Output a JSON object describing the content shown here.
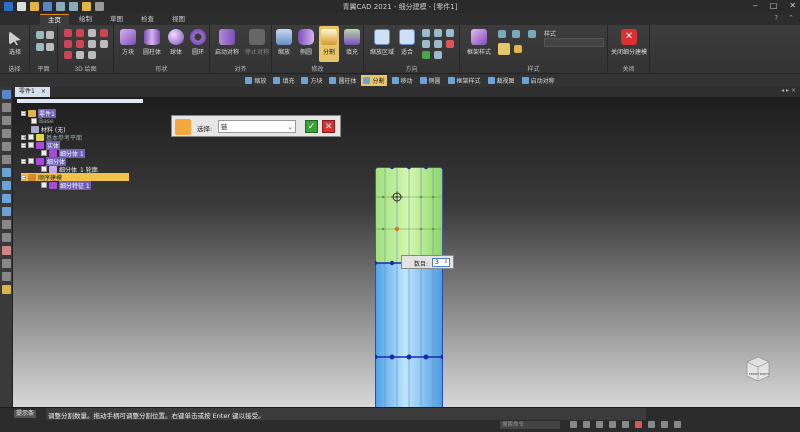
{
  "window": {
    "title": "青翼CAD 2021 - 细分建模 - [零件1]",
    "controls": [
      "‒",
      "□",
      "✕"
    ]
  },
  "ribbon_tabs": [
    "主页",
    "绘制",
    "草图",
    "检查",
    "视图"
  ],
  "ribbon_tab_active": "主页",
  "ribbon": {
    "groups": {
      "select": "选择",
      "plane": "平面",
      "sketch3d": "3D 绘图",
      "shape": "形状",
      "align": "对齐",
      "modify": "修改",
      "direction": "方向",
      "style": "样式",
      "close": "关闭"
    },
    "buttons": {
      "select": "选择",
      "box": "方块",
      "cylinder": "圆柱体",
      "sphere": "球体",
      "torus": "圆环",
      "start_align": "启动对称",
      "stop_align": "停止对称",
      "scale": "缩放",
      "side": "侧圆",
      "split": "分割",
      "fill": "填充",
      "zoom_area": "缩放区域",
      "fit": "适合",
      "frame_style": "框架样式",
      "style_label": "样式",
      "close_subdivision": "关闭细分建模"
    }
  },
  "command_strip": [
    {
      "label": "缩放",
      "selected": false
    },
    {
      "label": "填充",
      "selected": false
    },
    {
      "label": "方块",
      "selected": false
    },
    {
      "label": "圆柱体",
      "selected": false
    },
    {
      "label": "分割",
      "selected": true
    },
    {
      "label": "移动",
      "selected": false
    },
    {
      "label": "侧圆",
      "selected": false
    },
    {
      "label": "框架样式",
      "selected": false
    },
    {
      "label": "裁视图",
      "selected": false
    },
    {
      "label": "启动对称",
      "selected": false
    }
  ],
  "doc_tab": "零件1",
  "tree": {
    "root": "零件1",
    "base": "Base",
    "material": "材料 (无)",
    "ref_plane": "基本参考平面",
    "body1": "实体",
    "body1_sub": "细分体 1",
    "body2": "细分体",
    "body2_sub": "细分体_1 轮廓",
    "seq": "顺序建模",
    "seq_feature": "细分特征 1"
  },
  "select_dialog": {
    "label": "选择:",
    "value": "链",
    "ok": "✓",
    "cancel": "✕"
  },
  "count_box": {
    "label": "数目:",
    "value": "3"
  },
  "view_cube": {
    "face_left": "FRONT",
    "face_right": "RIGHT"
  },
  "status": {
    "hint_label": "提示条",
    "hint": "调整分割数量。拖动手柄可调整分割位置。右键单击或按 Enter 键以接受。",
    "search_placeholder": "搜索命令"
  }
}
